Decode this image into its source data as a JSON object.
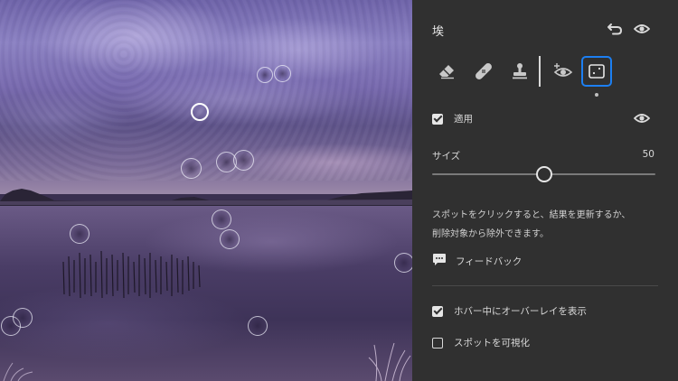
{
  "panel": {
    "title": "埃",
    "reset_icon": "undo-icon",
    "visibility_icon": "eye-icon",
    "tools": [
      {
        "name": "eraser",
        "icon": "eraser-icon"
      },
      {
        "name": "heal",
        "icon": "bandage-icon"
      },
      {
        "name": "clone",
        "icon": "stamp-icon"
      },
      {
        "name": "add-visibility",
        "icon": "eye-plus-icon"
      },
      {
        "name": "dust-removal",
        "icon": "dust-frame-icon",
        "selected": true
      }
    ],
    "apply": {
      "label": "適用",
      "checked": true
    },
    "size": {
      "label": "サイズ",
      "value": "50",
      "fraction": 0.5
    },
    "description_line1": "スポットをクリックすると、結果を更新するか、",
    "description_line2": "削除対象から除外できます。",
    "feedback_label": "フィードバック",
    "show_overlay": {
      "label": "ホバー中にオーバーレイを表示",
      "checked": true
    },
    "visualize_spots": {
      "label": "スポットを可視化",
      "checked": false
    }
  },
  "colors": {
    "panel_bg": "#303030",
    "accent": "#1c7ff2",
    "text": "#d9d9d9"
  }
}
